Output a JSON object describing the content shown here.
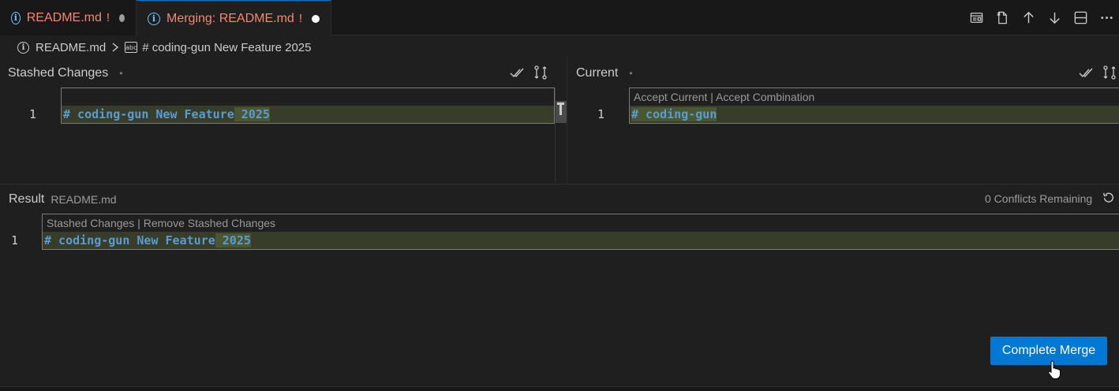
{
  "tabs": [
    {
      "label": "README.md",
      "mark": "!",
      "modified": true
    },
    {
      "label": "Merging: README.md",
      "mark": "!",
      "modified": true,
      "active": true
    }
  ],
  "toolbar_icons": [
    "open-preview-icon",
    "open-file-icon",
    "previous-conflict-icon",
    "next-conflict-icon",
    "split-editor-icon",
    "more-actions-icon"
  ],
  "breadcrumb": {
    "file": "README.md",
    "separator": ">",
    "symbol": "# coding-gun New Feature 2025"
  },
  "panes": {
    "stashed": {
      "title": "Stashed Changes",
      "dot": "•",
      "line_number": "1",
      "code_before": "# coding-gun New Feature",
      "code_diff": " 2025"
    },
    "current": {
      "title": "Current",
      "dot": "•",
      "codelens": "Accept Current | Accept Combination",
      "line_number": "1",
      "code": "# coding-gun"
    },
    "result": {
      "title": "Result",
      "file": "README.md",
      "status": "0 Conflicts Remaining",
      "codelens": "Stashed Changes | Remove Stashed Changes",
      "line_number": "1",
      "code_before": "# coding-gun New Feature",
      "code_diff": " 2025"
    }
  },
  "buttons": {
    "complete_merge": "Complete Merge"
  },
  "colors": {
    "accent": "#0078d4",
    "modified_tab": "#f48771",
    "keyword": "#569cd6",
    "diff_line": "#373d29",
    "diff_word": "#4b5632"
  }
}
